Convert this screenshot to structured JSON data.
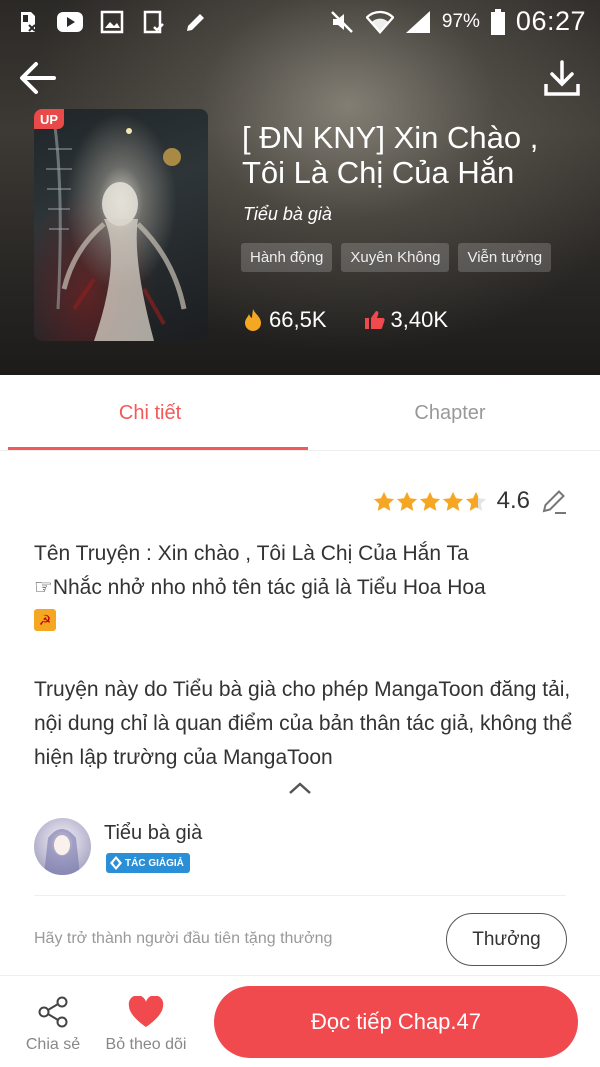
{
  "status_bar": {
    "battery_percent": "97%",
    "time": "06:27",
    "left_icons": [
      "sim-x-icon",
      "youtube-icon",
      "image-icon",
      "tablet-check-icon",
      "pencil-icon"
    ],
    "right_icons": [
      "mute-icon",
      "wifi-icon",
      "signal-icon",
      "battery-icon"
    ]
  },
  "header": {
    "back_icon": "arrow-left-icon",
    "download_icon": "download-icon"
  },
  "book": {
    "badge": "UP",
    "title": "[ ĐN KNY] Xin Chào , Tôi Là Chị Của Hắn",
    "author": "Tiểu bà già",
    "tags": [
      "Hành động",
      "Xuyên Không",
      "Viễn tưởng"
    ],
    "views": "66,5K",
    "likes": "3,40K"
  },
  "tabs": {
    "detail": "Chi tiết",
    "chapter": "Chapter",
    "active": "detail"
  },
  "rating": {
    "value": "4.6",
    "stars": 4.6
  },
  "description": {
    "line1": "Tên Truyện : Xin chào , Tôi Là Chị Của Hắn Ta",
    "line2_prefix": "☞",
    "line2": "Nhắc nhở nho nhỏ tên tác giả là Tiểu Hoa Hoa",
    "disclaimer": "Truyện này do Tiểu bà già cho phép MangaToon đăng tải, nội dung chỉ là quan điểm của bản thân tác giả, không thể hiện lập trường của MangaToon"
  },
  "author_card": {
    "name": "Tiểu bà già",
    "badge": "TÁC GIẢGIẢ"
  },
  "gift": {
    "prompt": "Hãy trở thành người đầu tiên tặng thưởng",
    "button": "Thưởng"
  },
  "bottom_bar": {
    "share_label": "Chia sẻ",
    "follow_label": "Bỏ theo dõi",
    "read_button": "Đọc tiếp Chap.47"
  },
  "colors": {
    "accent": "#f04a4f",
    "tab_active": "#f25a5a",
    "star": "#f5a623",
    "author_badge": "#2a8fd6"
  }
}
